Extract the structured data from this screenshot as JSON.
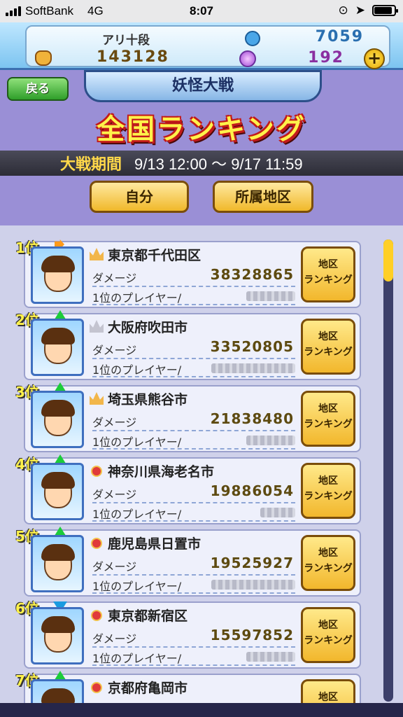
{
  "status_bar": {
    "carrier": "SoftBank",
    "network": "4G",
    "time": "8:07",
    "battery": 0.9
  },
  "header": {
    "rank_name": "アリ十段",
    "money": "143128",
    "bell_points": "7059",
    "orb_count": "192",
    "plus": "+"
  },
  "nav": {
    "back_label": "戻る",
    "section_title": "妖怪大戦"
  },
  "page_title": "全国ランキング",
  "period": {
    "label": "大戦期間",
    "range": "9/13 12:00 〜 9/17 11:59"
  },
  "filters": {
    "self_label": "自分",
    "region_label": "所属地区"
  },
  "list": {
    "damage_label": "ダメージ",
    "top_player_label": "1位のプレイヤー/",
    "button_label_line1": "地区",
    "button_label_line2": "ランキング",
    "scroll_position": 0.0,
    "rows": [
      {
        "rank": "1位",
        "trend": "flat",
        "icon": "gold-crown-icon",
        "city": "東京都千代田区",
        "damage": "38328865"
      },
      {
        "rank": "2位",
        "trend": "up",
        "icon": "silver-crown-icon",
        "city": "大阪府吹田市",
        "damage": "33520805"
      },
      {
        "rank": "3位",
        "trend": "up",
        "icon": "bronze-crown-icon",
        "city": "埼玉県熊谷市",
        "damage": "21838480"
      },
      {
        "rank": "4位",
        "trend": "up",
        "icon": "medal-icon",
        "city": "神奈川県海老名市",
        "damage": "19886054"
      },
      {
        "rank": "5位",
        "trend": "up",
        "icon": "medal-icon",
        "city": "鹿児島県日置市",
        "damage": "19525927"
      },
      {
        "rank": "6位",
        "trend": "down",
        "icon": "medal-icon",
        "city": "東京都新宿区",
        "damage": "15597852"
      },
      {
        "rank": "7位",
        "trend": "up",
        "icon": "medal-icon",
        "city": "京都府亀岡市",
        "damage": ""
      }
    ]
  },
  "colors": {
    "title_fill": "#fff24a",
    "title_outline": "#c21a1a",
    "accent_gold": "#f2b72c",
    "panel_bg": "#eef0fb"
  }
}
